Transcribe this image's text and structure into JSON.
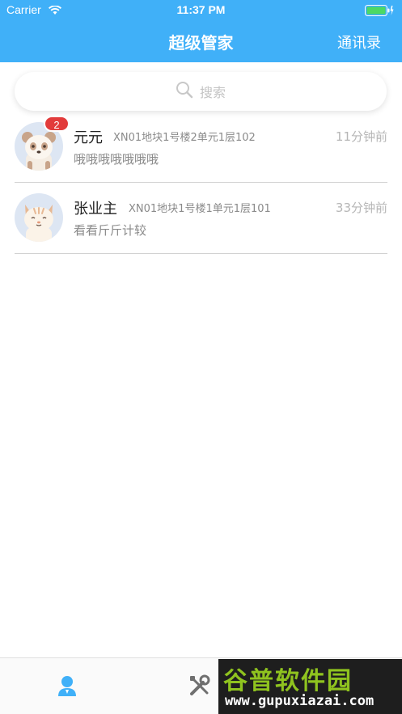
{
  "status_bar": {
    "carrier": "Carrier",
    "time": "11:37 PM"
  },
  "nav": {
    "title": "超级管家",
    "right_button": "通讯录"
  },
  "search": {
    "placeholder": "搜索"
  },
  "chats": [
    {
      "name": "元元",
      "address": "XN01地块1号楼2单元1层102",
      "time": "11分钟前",
      "message": "哦哦哦哦哦哦哦",
      "unread": "2",
      "avatar": "panda-avatar"
    },
    {
      "name": "张业主",
      "address": "XN01地块1号楼1单元1层101",
      "time": "33分钟前",
      "message": "看看斤斤计较",
      "avatar": "cat-avatar"
    }
  ],
  "tabbar": {
    "icons": [
      "user-icon",
      "tools-icon"
    ]
  },
  "watermark": {
    "title": "谷普软件园",
    "url": "www.gupuxiazai.com"
  },
  "colors": {
    "primary": "#40b0f8",
    "badge": "#e23b3b",
    "watermark_green": "#8fc31f"
  }
}
